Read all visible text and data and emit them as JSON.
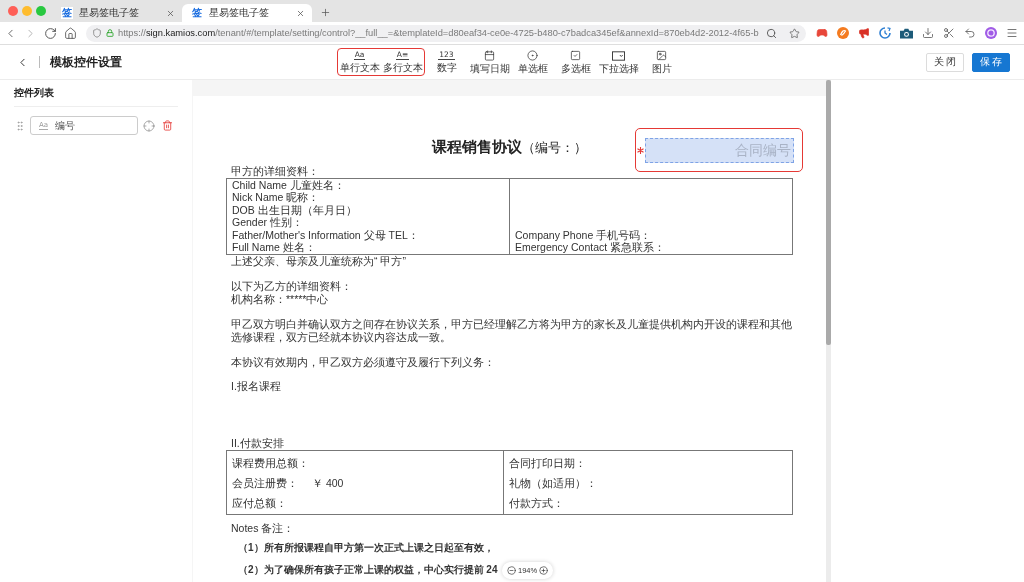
{
  "browser": {
    "tabs": [
      {
        "icon_text": "签",
        "title": "星易签电子签",
        "selected": false
      },
      {
        "icon_text": "签",
        "title": "星易签电子签",
        "selected": true
      }
    ],
    "url": {
      "scheme": "https://",
      "host": "sign.kamios.com",
      "path": "/tenant/#/template/setting/control?__full__=&templateId=d80eaf34-ce0e-4725-b480-c7badca345ef&annexId=870eb4d2-2012-4f65-b"
    }
  },
  "header": {
    "title": "模板控件设置",
    "toolbar": [
      {
        "kind": "single-text",
        "glyph": "Aa",
        "label": "单行文本",
        "highlighted": true
      },
      {
        "kind": "multi-text",
        "glyph": "A≡",
        "label": "多行文本",
        "highlighted": true
      },
      {
        "kind": "number",
        "glyph": "123",
        "label": "数字",
        "highlighted": false
      },
      {
        "kind": "date",
        "label": "填写日期",
        "highlighted": false
      },
      {
        "kind": "radio",
        "label": "单选框",
        "highlighted": false
      },
      {
        "kind": "checkbox",
        "label": "多选框",
        "highlighted": false
      },
      {
        "kind": "select",
        "label": "下拉选择",
        "highlighted": false
      },
      {
        "kind": "image",
        "label": "图片",
        "highlighted": false
      }
    ],
    "buttons": [
      {
        "kind": "default",
        "label": "关闭"
      },
      {
        "kind": "primary",
        "label": "保存"
      }
    ]
  },
  "sidebar": {
    "title": "控件列表",
    "controls": [
      {
        "glyph": "Aa",
        "label": "编号"
      }
    ]
  },
  "document": {
    "title": "课程销售协议",
    "title_note": "（编号：）",
    "number_field": {
      "placeholder": "合同编号",
      "required": true,
      "highlighted": true
    },
    "party_a": {
      "heading": "甲方的详细资料：",
      "left": [
        "Child Name 儿童姓名：",
        "Nick Name 昵称：",
        "DOB 出生日期（年月日）",
        "Gender 性别：",
        "Father/Mother's Information 父母 TEL：",
        "Full Name 姓名："
      ],
      "right": [
        "Company Phone 手机号码：",
        "Emergency Contact 紧急联系："
      ],
      "note": "上述父亲、母亲及儿童统称为“ 甲方”"
    },
    "party_b": {
      "heading": "以下为乙方的详细资料：",
      "lines": [
        "机构名称：*****中心"
      ]
    },
    "agreement": "甲乙双方明白并确认双方之间存在协议关系，甲方已经理解乙方将为甲方的家长及儿童提供机构内开设的课程和其他选修课程，双方已经就本协议内容达成一致。",
    "obligations": "本协议有效期内，甲乙双方必须遵守及履行下列义务：",
    "section_1": {
      "heading": "I.报名课程"
    },
    "section_2": {
      "heading": "II.付款安排",
      "left": [
        {
          "label": "课程费用总额："
        },
        {
          "label": "会员注册费：",
          "value": "￥ 400"
        },
        {
          "label": "应付总额："
        }
      ],
      "right": [
        {
          "label": "合同打印日期："
        },
        {
          "label": "礼物（如适用）："
        },
        {
          "label": "付款方式："
        }
      ]
    },
    "notes": {
      "heading": "Notes 备注：",
      "items": [
        "（1）所有所报课程自甲方第一次正式上课之日起至有效，",
        "（2）为了确保所有孩子正常上课的权益，中心实行提前 24"
      ]
    }
  },
  "zoom": {
    "level_text": "194%"
  }
}
